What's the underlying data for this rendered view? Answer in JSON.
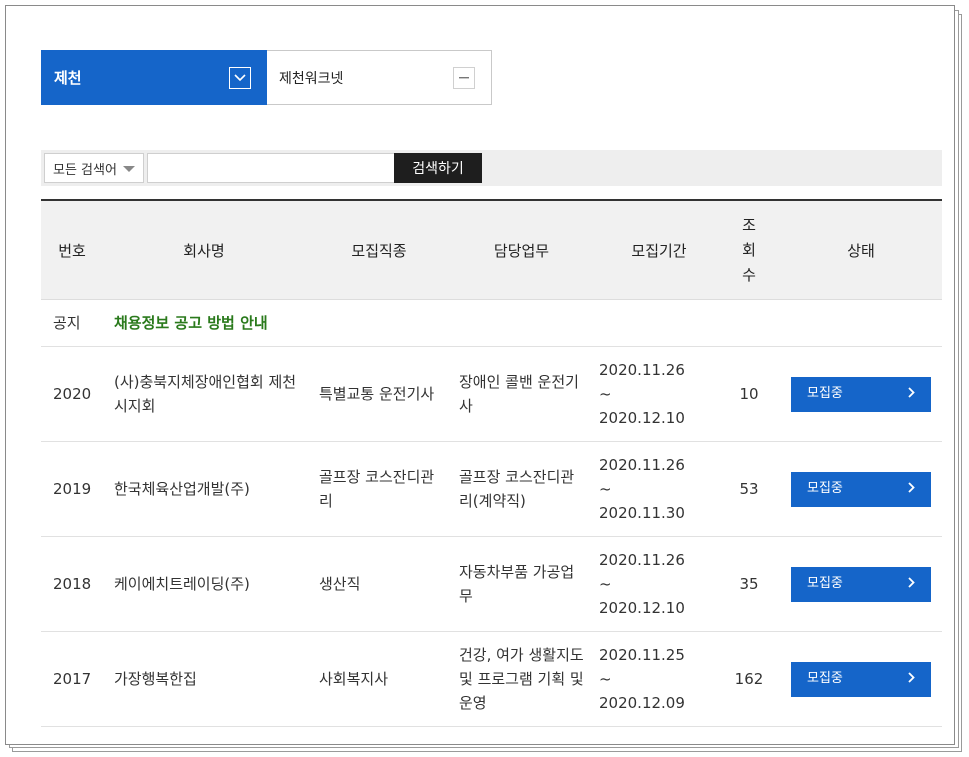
{
  "region": {
    "main_label": "제천",
    "sub_label": "제천워크넷"
  },
  "search": {
    "select_value": "모든 검색어",
    "input_value": "",
    "button_label": "검색하기"
  },
  "table": {
    "headers": {
      "num": "번호",
      "company": "회사명",
      "job": "모집직종",
      "duty": "담당업무",
      "period": "모집기간",
      "views": "조\n회\n수",
      "status": "상태"
    },
    "notice": {
      "label": "공지",
      "title": "채용정보 공고 방법 안내"
    },
    "rows": [
      {
        "num": "2020",
        "company": "(사)충북지체장애인협회 제천시지회",
        "job": "특별교통 운전기사",
        "duty": "장애인 콜밴 운전기사",
        "period_start": "2020.11.26",
        "period_sep": "~",
        "period_end": "2020.12.10",
        "views": "10",
        "status": "모집중"
      },
      {
        "num": "2019",
        "company": "한국체육산업개발(주)",
        "job": "골프장 코스잔디관리",
        "duty": "골프장 코스잔디관리(계약직)",
        "period_start": "2020.11.26",
        "period_sep": "~",
        "period_end": "2020.11.30",
        "views": "53",
        "status": "모집중"
      },
      {
        "num": "2018",
        "company": "케이에치트레이딩(주)",
        "job": "생산직",
        "duty": "자동차부품 가공업무",
        "period_start": "2020.11.26",
        "period_sep": "~",
        "period_end": "2020.12.10",
        "views": "35",
        "status": "모집중"
      },
      {
        "num": "2017",
        "company": "가장행복한집",
        "job": "사회복지사",
        "duty": "건강, 여가 생활지도 및 프로그램 기획 및 운영",
        "period_start": "2020.11.25",
        "period_sep": "~",
        "period_end": "2020.12.09",
        "views": "162",
        "status": "모집중"
      }
    ]
  },
  "colors": {
    "primary": "#1565c9",
    "notice_title": "#2a7a1c",
    "search_button": "#1e1e1e"
  },
  "icons": {
    "region_toggle": "chevron-down-icon",
    "sub_toggle": "minus-icon",
    "select_caret": "caret-down-icon",
    "status_arrow": "chevron-right-icon"
  }
}
